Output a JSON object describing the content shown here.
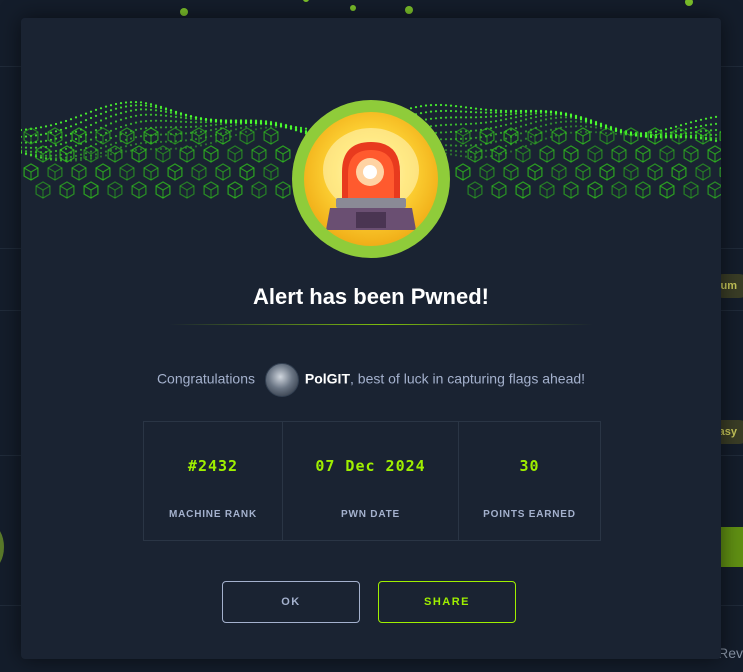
{
  "modal": {
    "title": "Alert has been Pwned!",
    "congrats_prefix": "Congratulations",
    "username": "PolGIT",
    "congrats_suffix": ", best of luck in capturing flags ahead!",
    "badge_icon": "siren-icon",
    "stats": [
      {
        "value": "#2432",
        "label": "MACHINE RANK"
      },
      {
        "value": "07 Dec 2024",
        "label": "PWN DATE"
      },
      {
        "value": "30",
        "label": "POINTS EARNED"
      }
    ],
    "ok_label": "OK",
    "share_label": "SHARE"
  },
  "background": {
    "pill_medium": "um",
    "pill_easy": "asy",
    "right_text": "Rev"
  },
  "colors": {
    "accent": "#9fef00",
    "panel": "#1a2332",
    "text_muted": "#a4b1cd"
  }
}
